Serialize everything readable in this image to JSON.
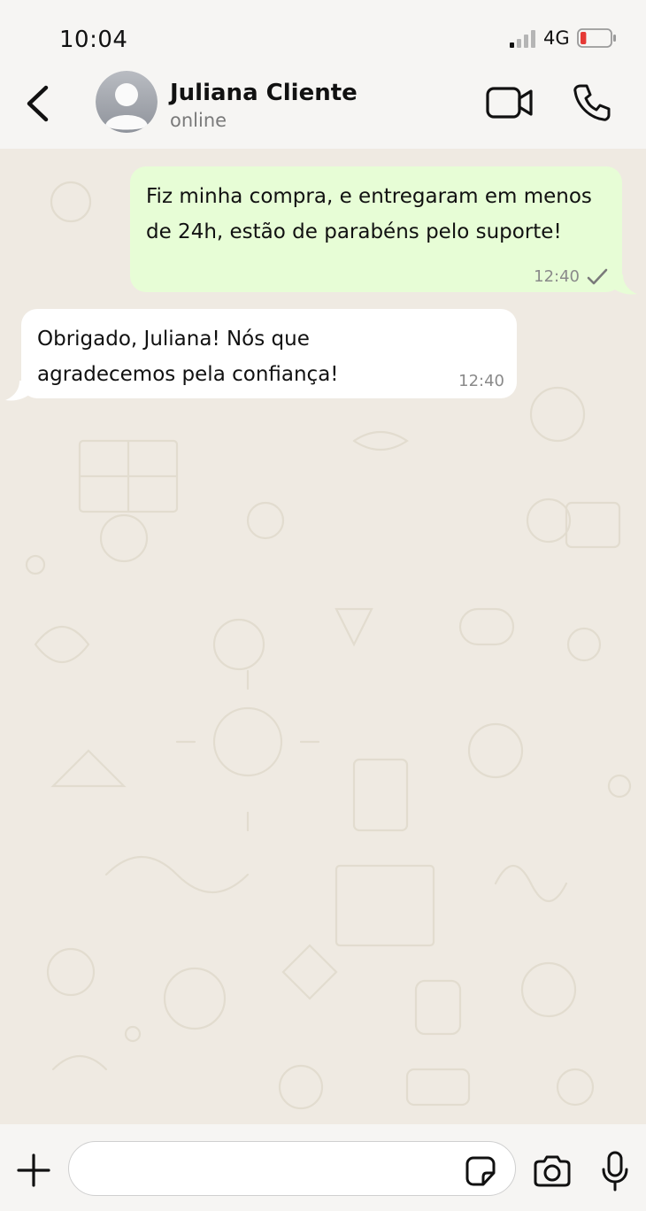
{
  "status_bar": {
    "time": "10:04",
    "network": "4G",
    "battery_level": 0.2,
    "battery_color": "#e53935"
  },
  "header": {
    "contact_name": "Juliana Cliente",
    "contact_status": "online",
    "icons": [
      "back-icon",
      "avatar",
      "video-call-icon",
      "phone-icon"
    ]
  },
  "messages": [
    {
      "direction": "outgoing",
      "text": "Fiz minha compra, e entregaram em menos de 24h, estão de parabéns pelo suporte!",
      "time": "12:40",
      "status": "sent",
      "bubble_color": "#e7fdd6"
    },
    {
      "direction": "incoming",
      "text": "Obrigado, Juliana! Nós que agradecemos pela confiança!",
      "time": "12:40",
      "bubble_color": "#ffffff"
    }
  ],
  "input_bar": {
    "placeholder": "",
    "value": "",
    "icons": [
      "plus-icon",
      "sticker-icon",
      "camera-icon",
      "mic-icon"
    ]
  },
  "colors": {
    "chat_background": "#efeae2",
    "header_background": "#f6f5f3",
    "icon_color": "#111111"
  }
}
